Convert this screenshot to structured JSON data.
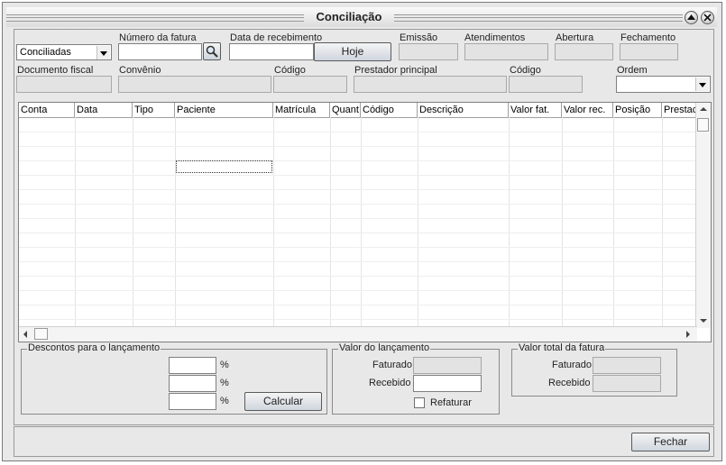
{
  "window": {
    "title": "Conciliação"
  },
  "filters": {
    "status_select": {
      "value": "Conciliadas"
    },
    "numero_fatura": {
      "label": "Número da fatura",
      "value": ""
    },
    "data_recebimento": {
      "label": "Data de recebimento",
      "value": ""
    },
    "hoje_button": "Hoje",
    "emissao": {
      "label": "Emissão"
    },
    "atendimentos": {
      "label": "Atendimentos"
    },
    "abertura": {
      "label": "Abertura"
    },
    "fechamento": {
      "label": "Fechamento"
    },
    "documento_fiscal": {
      "label": "Documento fiscal"
    },
    "convenio": {
      "label": "Convênio"
    },
    "codigo_convenio": {
      "label": "Código"
    },
    "prestador_principal": {
      "label": "Prestador principal"
    },
    "codigo_prestador": {
      "label": "Código"
    },
    "ordem": {
      "label": "Ordem",
      "value": ""
    }
  },
  "grid": {
    "columns": [
      "Conta",
      "Data",
      "Tipo",
      "Paciente",
      "Matrícula",
      "Quant.",
      "Código",
      "Descrição",
      "Valor fat.",
      "Valor rec.",
      "Posição",
      "Prestac"
    ],
    "rows": []
  },
  "descontos": {
    "title": "Descontos para o lançamento",
    "percent_symbol": "%",
    "calcular_button": "Calcular"
  },
  "valor_lancamento": {
    "title": "Valor do lançamento",
    "faturado_label": "Faturado",
    "recebido_label": "Recebido",
    "refaturar_label": "Refaturar"
  },
  "valor_total": {
    "title": "Valor total da fatura",
    "faturado_label": "Faturado",
    "recebido_label": "Recebido"
  },
  "footer": {
    "fechar_button": "Fechar"
  }
}
